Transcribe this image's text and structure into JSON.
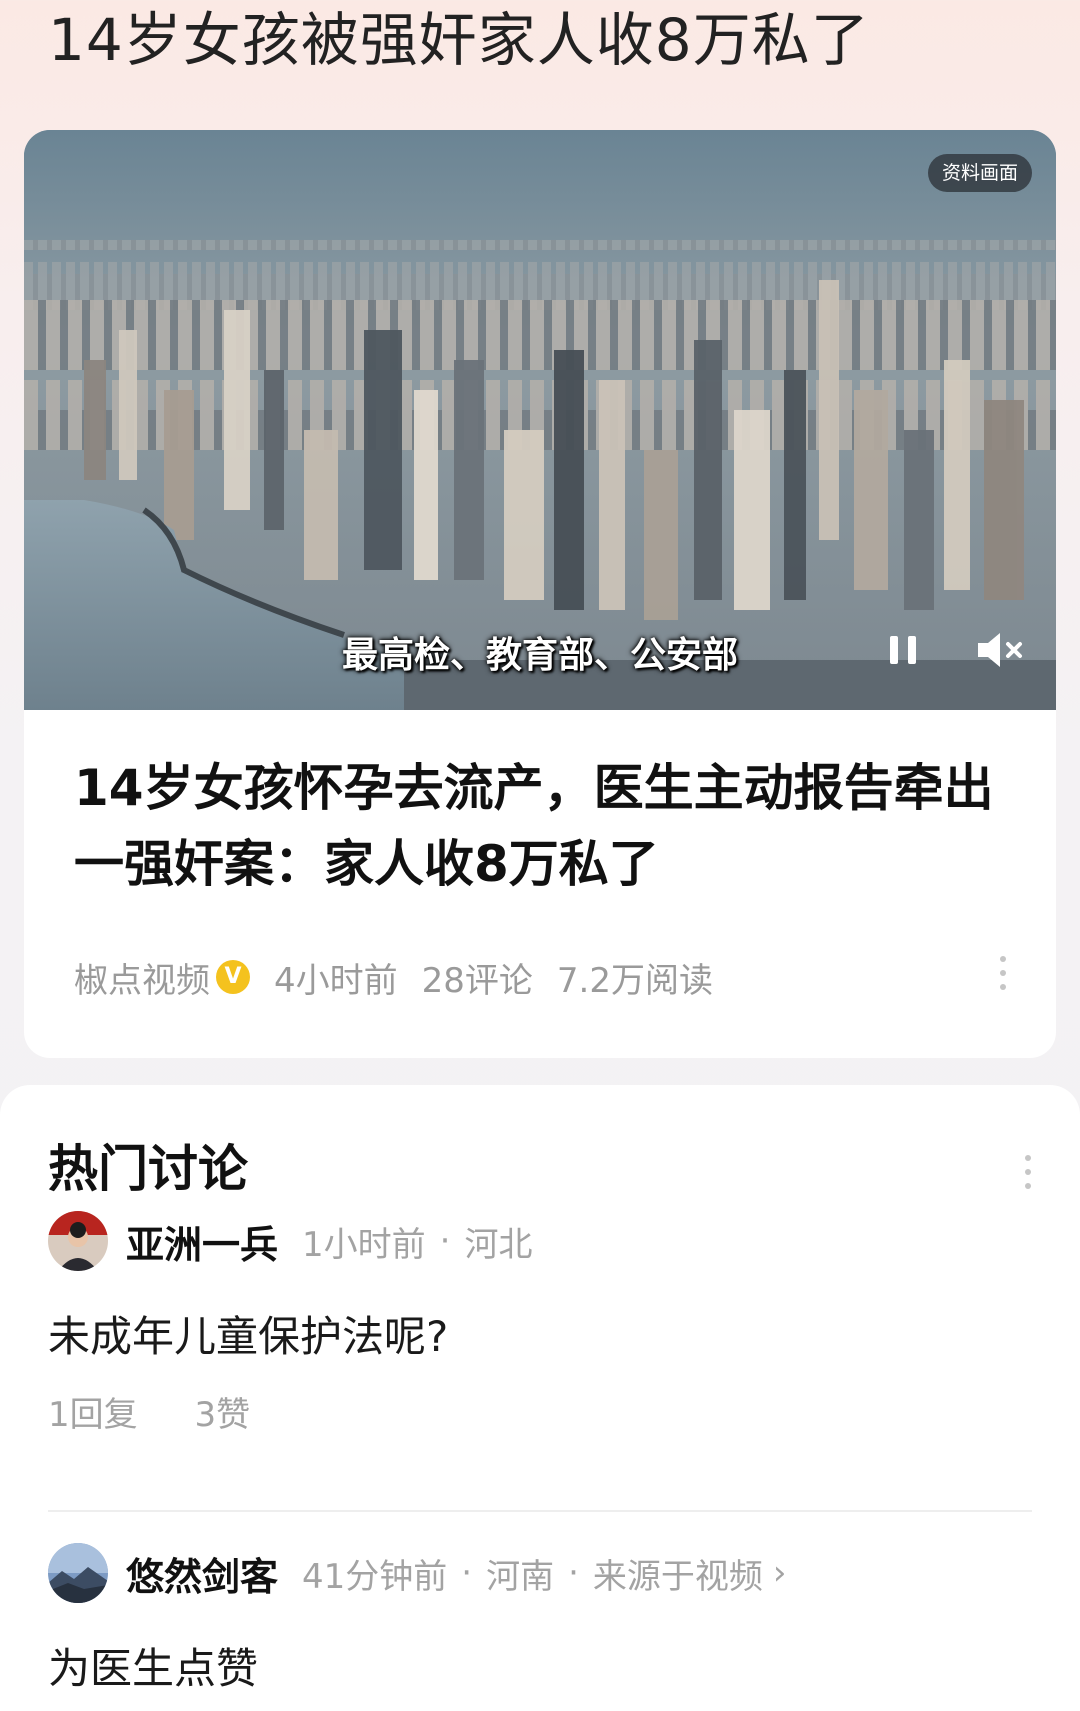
{
  "topic": {
    "title": "14岁女孩被强奸家人收8万私了"
  },
  "video": {
    "badge": "资料画面",
    "subtitle": "最高检、教育部、公安部",
    "controls": {
      "pause_icon": "pause-icon",
      "mute_icon": "speaker-muted-icon"
    }
  },
  "article": {
    "title": "14岁女孩怀孕去流产，医生主动报告牵出一强奸案：家人收8万私了",
    "source": "椒点视频",
    "verified_mark": "V",
    "time": "4小时前",
    "comments": "28评论",
    "reads": "7.2万阅读"
  },
  "discussion": {
    "title": "热门讨论",
    "comments": [
      {
        "name": "亚洲一兵",
        "time": "1小时前",
        "location": "河北",
        "text": "未成年儿童保护法呢?",
        "replies": "1回复",
        "likes": "3赞"
      },
      {
        "name": "悠然剑客",
        "time": "41分钟前",
        "location": "河南",
        "source": "来源于视频",
        "text": "为医生点赞"
      }
    ]
  },
  "colors": {
    "verified": "#f4c21e",
    "muted_text": "#9a9a9a"
  }
}
